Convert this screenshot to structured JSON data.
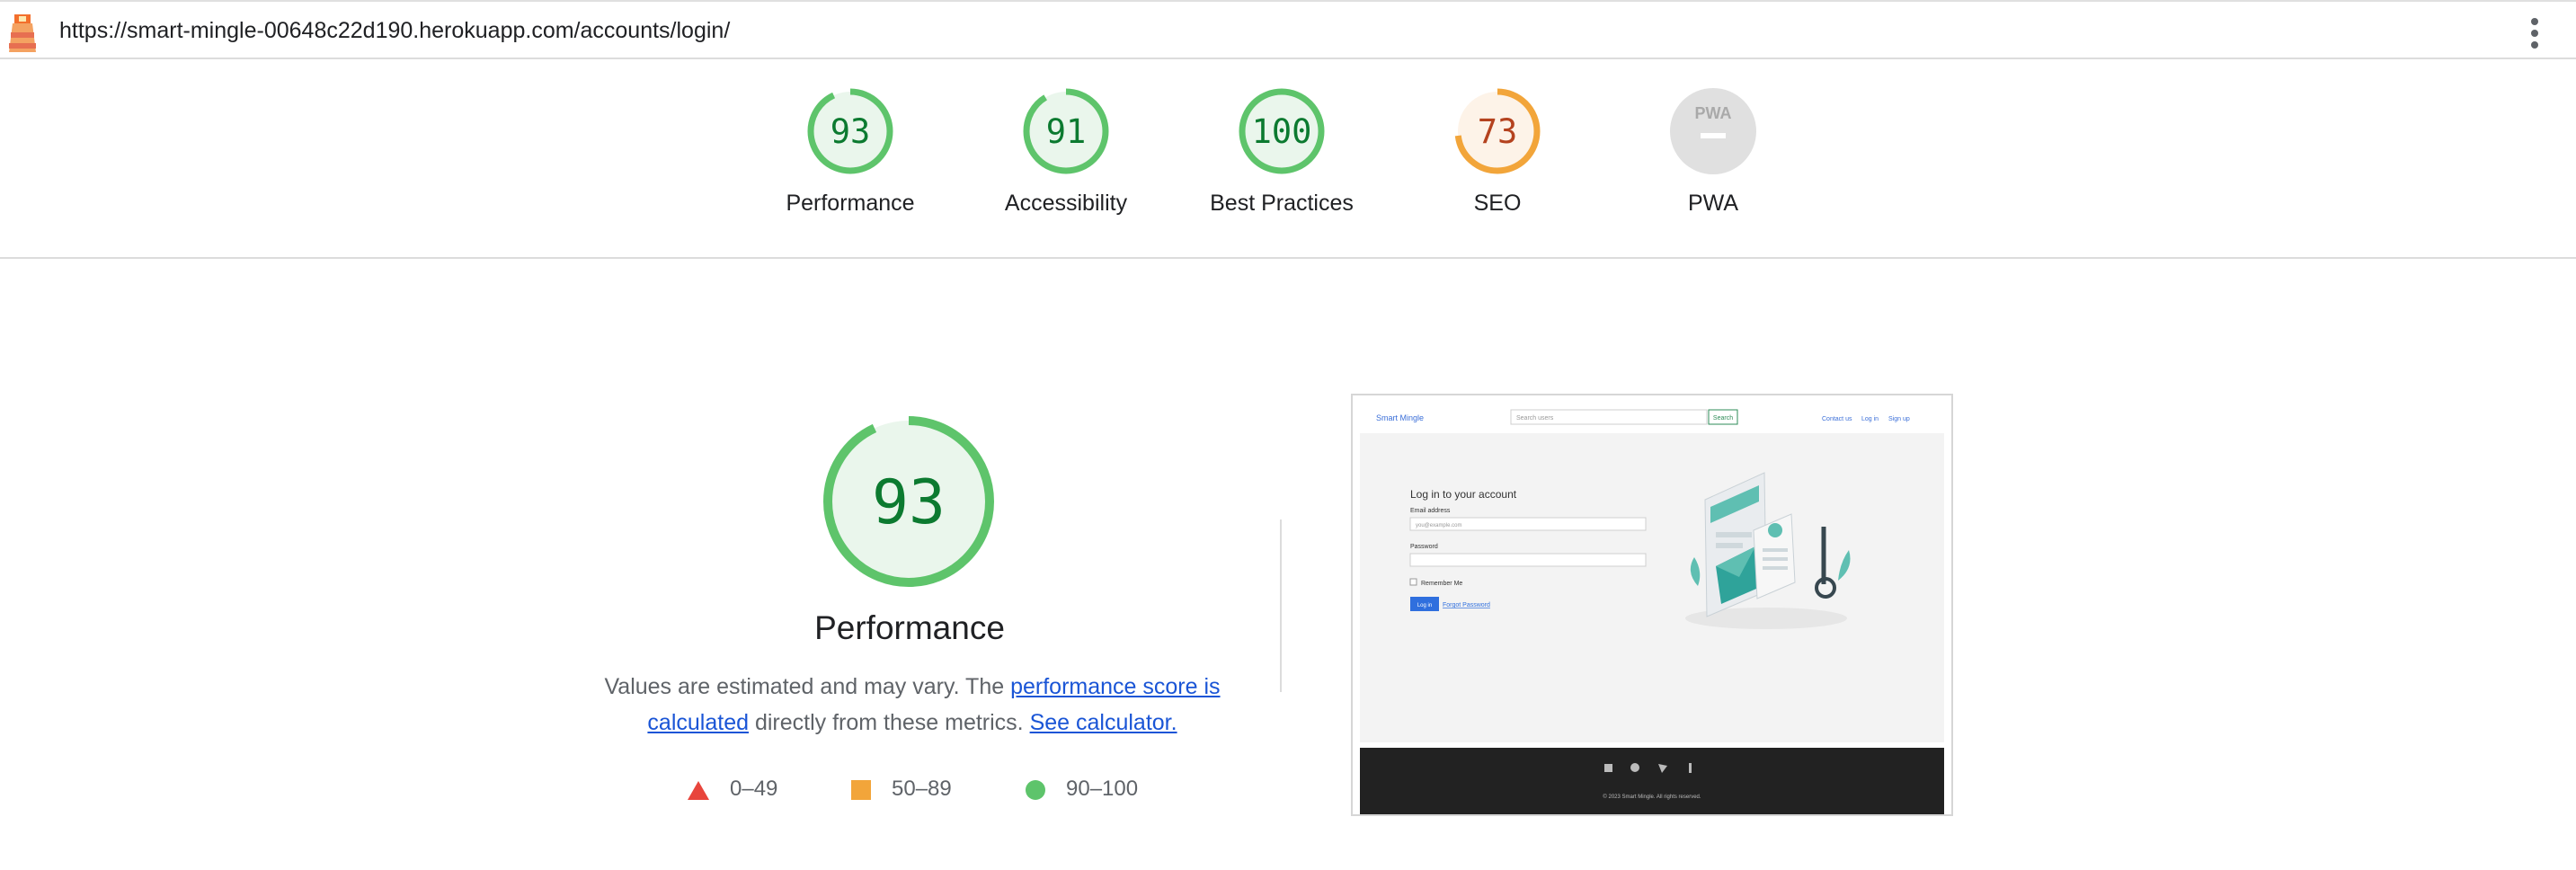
{
  "browser": {
    "url": "https://smart-mingle-00648c22d190.herokuapp.com/accounts/login/"
  },
  "categories": [
    {
      "label": "Performance",
      "score": "93",
      "value": 93,
      "status": "pass"
    },
    {
      "label": "Accessibility",
      "score": "91",
      "value": 91,
      "status": "pass"
    },
    {
      "label": "Best Practices",
      "score": "100",
      "value": 100,
      "status": "pass"
    },
    {
      "label": "SEO",
      "score": "73",
      "value": 73,
      "status": "average"
    },
    {
      "label": "PWA",
      "badge": "PWA",
      "status": "na"
    }
  ],
  "performance": {
    "score": "93",
    "value": 93,
    "title": "Performance",
    "desc_prefix": "Values are estimated and may vary. The ",
    "desc_link1": "performance score is calculated",
    "desc_middle": " directly from these metrics. ",
    "desc_link2": "See calculator."
  },
  "legend": [
    {
      "range": "0–49",
      "shape": "triangle",
      "color": "#e8453c"
    },
    {
      "range": "50–89",
      "shape": "square",
      "color": "#f2a53a"
    },
    {
      "range": "90–100",
      "shape": "circle",
      "color": "#5ec46b"
    }
  ],
  "colors": {
    "pass": "#0c9d3c",
    "pass_ring": "#5ec46b",
    "pass_fill": "#eaf6ec",
    "average": "#b4421e",
    "average_ring": "#f2a53a",
    "average_fill": "#fdf3e8",
    "link": "#1a55d6"
  },
  "screenshot": {
    "brand": "Smart Mingle",
    "search_placeholder": "Search users",
    "search_button": "Search",
    "nav": [
      "Contact us",
      "Log in",
      "Sign up"
    ],
    "heading": "Log in to your account",
    "email_label": "Email address",
    "email_placeholder": "you@example.com",
    "password_label": "Password",
    "remember_label": "Remember Me",
    "login_button": "Log in",
    "forgot_link": "Forgot Password",
    "footer_text": "© 2023 Smart Mingle. All rights reserved."
  }
}
